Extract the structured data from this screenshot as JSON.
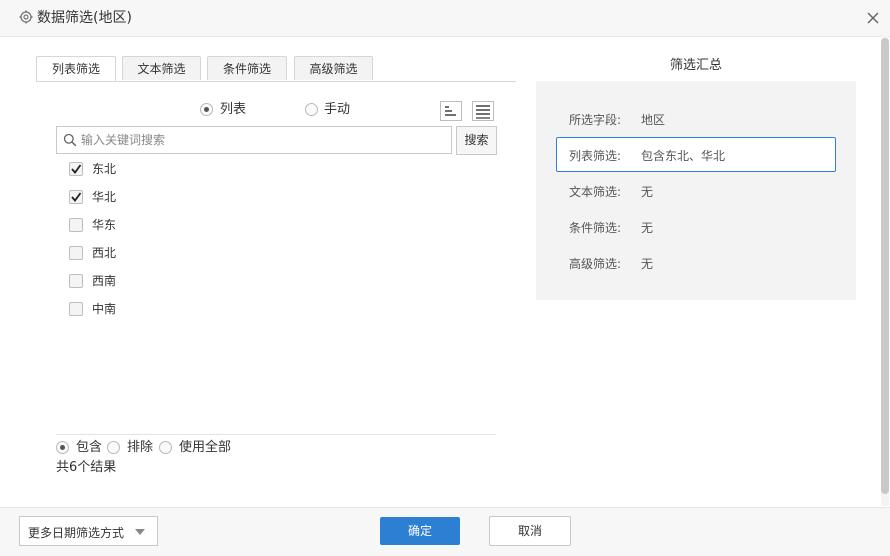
{
  "dialog": {
    "title": "数据筛选(地区)"
  },
  "tabs": [
    {
      "label": "列表筛选",
      "active": true
    },
    {
      "label": "文本筛选",
      "active": false
    },
    {
      "label": "条件筛选",
      "active": false
    },
    {
      "label": "高级筛选",
      "active": false
    }
  ],
  "mode": {
    "list_label": "列表",
    "manual_label": "手动",
    "selected": "列表"
  },
  "search": {
    "placeholder": "输入关键词搜索",
    "value": "",
    "button_label": "搜索"
  },
  "items": [
    {
      "label": "东北",
      "checked": true
    },
    {
      "label": "华北",
      "checked": true
    },
    {
      "label": "华东",
      "checked": false
    },
    {
      "label": "西北",
      "checked": false
    },
    {
      "label": "西南",
      "checked": false
    },
    {
      "label": "中南",
      "checked": false
    }
  ],
  "match_mode": {
    "include_label": "包含",
    "exclude_label": "排除",
    "all_label": "使用全部",
    "selected": "包含"
  },
  "result_count_text": "共6个结果",
  "summary": {
    "title": "筛选汇总",
    "rows": [
      {
        "label": "所选字段:",
        "value": "地区"
      },
      {
        "label": "列表筛选:",
        "value": "包含东北、华北"
      },
      {
        "label": "文本筛选:",
        "value": "无"
      },
      {
        "label": "条件筛选:",
        "value": "无"
      },
      {
        "label": "高级筛选:",
        "value": "无"
      }
    ]
  },
  "footer": {
    "more_label": "更多日期筛选方式",
    "ok_label": "确定",
    "cancel_label": "取消"
  },
  "colors": {
    "accent": "#2d7fd3",
    "highlight_border": "#2f7fd6",
    "panel_bg": "#f3f3f3"
  },
  "icons": {
    "title": "gear-icon",
    "close": "close-icon",
    "search": "search-icon",
    "sort": "sort-icon",
    "list": "list-icon",
    "dropdown": "caret-down-icon"
  }
}
